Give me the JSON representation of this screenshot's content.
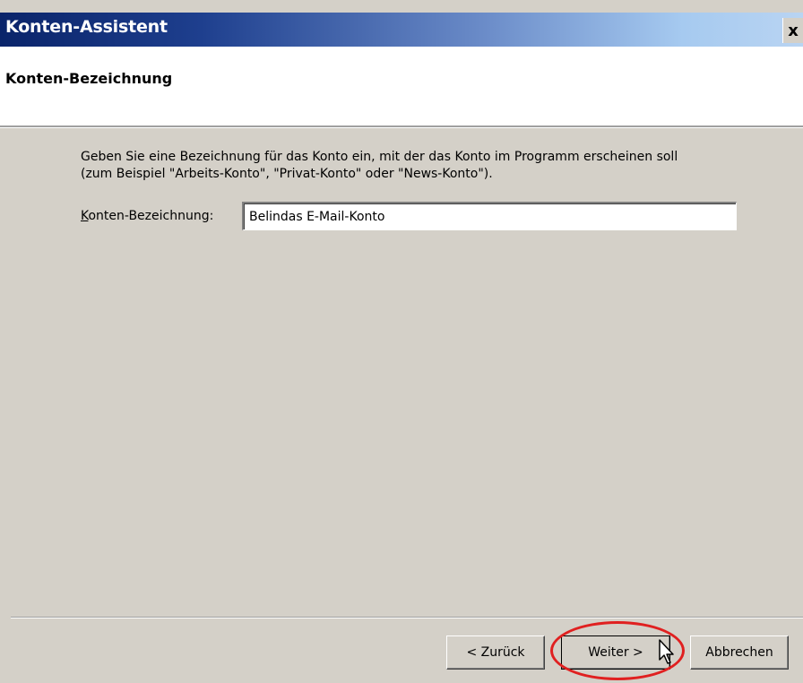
{
  "window": {
    "title": "Konten-Assistent",
    "close_glyph": "x"
  },
  "header": {
    "title": "Konten-Bezeichnung"
  },
  "main": {
    "description_line1": "Geben Sie eine Bezeichnung für das Konto ein, mit der das Konto im Programm erscheinen soll",
    "description_line2": "(zum Beispiel \"Arbeits-Konto\", \"Privat-Konto\" oder \"News-Konto\").",
    "field_label_accel": "K",
    "field_label_rest": "onten-Bezeichnung:",
    "field_value": "Belindas E-Mail-Konto"
  },
  "buttons": {
    "back": "< Zurück",
    "next": "Weiter >",
    "cancel": "Abbrechen"
  },
  "colors": {
    "highlight": "#e02020",
    "title_start": "#0a246a",
    "dialog_bg": "#d4d0c8"
  },
  "icons": {
    "close": "close-icon",
    "cursor": "mouse-pointer-icon"
  }
}
